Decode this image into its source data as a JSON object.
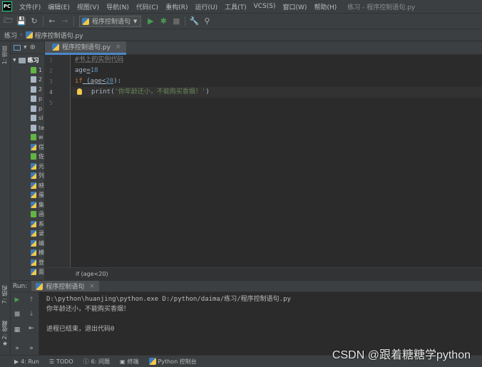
{
  "window": {
    "logo": "PC",
    "title": "练习 - 程序控制语句.py"
  },
  "menu": [
    "文件(F)",
    "编辑(E)",
    "视图(V)",
    "导航(N)",
    "代码(C)",
    "重构(R)",
    "运行(U)",
    "工具(T)",
    "VCS(S)",
    "窗口(W)",
    "帮助(H)"
  ],
  "toolbar": {
    "run_config": "程序控制语句"
  },
  "navbar": {
    "project": "练习",
    "file": "程序控制语句.py"
  },
  "left_stripe": {
    "project_tab": "1: 项目",
    "structure_tab": "7: 结构",
    "favorites_tab": "2: 收藏"
  },
  "project_panel": {
    "root": "练习",
    "items": [
      "1",
      "2",
      "2",
      "p",
      "p",
      "sl",
      "te",
      "w",
      "信",
      "佐",
      "元",
      "列",
      "映",
      "蛋",
      "集",
      "函",
      "系",
      "录",
      "编",
      "模",
      "登",
      "面"
    ]
  },
  "editor": {
    "tab": "程序控制语句.py",
    "line_numbers": [
      "1",
      "2",
      "3",
      "4",
      "5"
    ],
    "code": {
      "comment": "#书上的实例代码",
      "l2_var": "age",
      "l2_op": "=",
      "l2_num": "18",
      "l3_kw": "if",
      "l3_cond_a": " (age<",
      "l3_num": "20",
      "l3_cond_b": "):",
      "l4_fn": "print(",
      "l4_str": "'你年龄还小，不能购买香烟！'",
      "l4_end": ")"
    },
    "breadcrumb": "if (age<20)"
  },
  "run": {
    "label": "Run:",
    "tab": "程序控制语句",
    "console": [
      "D:\\python\\huanjing\\python.exe D:/python/daima/练习/程序控制语句.py",
      "你年龄还小，不能购买香烟！",
      "",
      "进程已结束，退出代码0"
    ]
  },
  "bottom_tools": {
    "run": "4: Run",
    "todo": "TODO",
    "problems": "6: 问题",
    "terminal": "终端",
    "python_console": "Python 控制台"
  },
  "watermark": "CSDN @跟着糖糖学python",
  "colors": {
    "background": "#2b2b2b",
    "keyword": "#cc7832",
    "number": "#6897bb",
    "string": "#6a8759",
    "comment": "#808080",
    "run_green": "#499c54"
  }
}
